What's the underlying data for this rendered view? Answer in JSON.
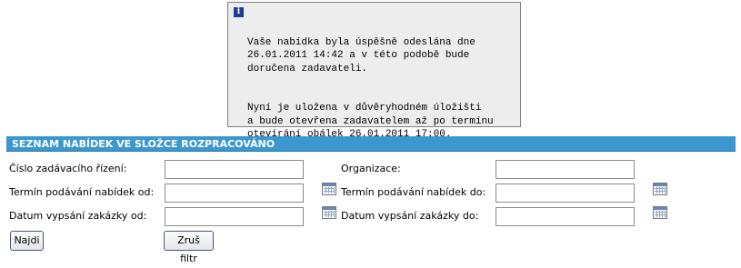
{
  "notice": {
    "icon": "info-icon",
    "line1": "Vaše nabídka byla úspěšně odeslána dne\n26.01.2011 14:42 a v této podobě bude\ndoručena zadavateli.",
    "line2": "Nyní je uložena v důvěryhodném úložišti\na bude otevřena zadavatelem až po termínu\notevírání obálek 26.01.2011 17:00."
  },
  "section": {
    "title": "SEZNAM NABÍDEK VE SLOŽCE ROZPRACOVÁNO"
  },
  "filters": {
    "cislo_label": "Číslo zadávacího řízení:",
    "cislo_value": "",
    "organizace_label": "Organizace:",
    "organizace_value": "",
    "termin_od_label": "Termín podávání nabídek od:",
    "termin_od_value": "",
    "termin_do_label": "Termín podávání nabídek do:",
    "termin_do_value": "",
    "datum_od_label": "Datum vypsání zakázky od:",
    "datum_od_value": "",
    "datum_do_label": "Datum vypsání zakázky do:",
    "datum_do_value": "",
    "calendar_icon": "calendar-icon"
  },
  "buttons": {
    "search_label": "Najdi",
    "reset_label": "Zruš filtr"
  },
  "colors": {
    "header_bg": "#3d97cf",
    "notice_bg": "#ededed",
    "info_icon": "#1f3d9a"
  }
}
